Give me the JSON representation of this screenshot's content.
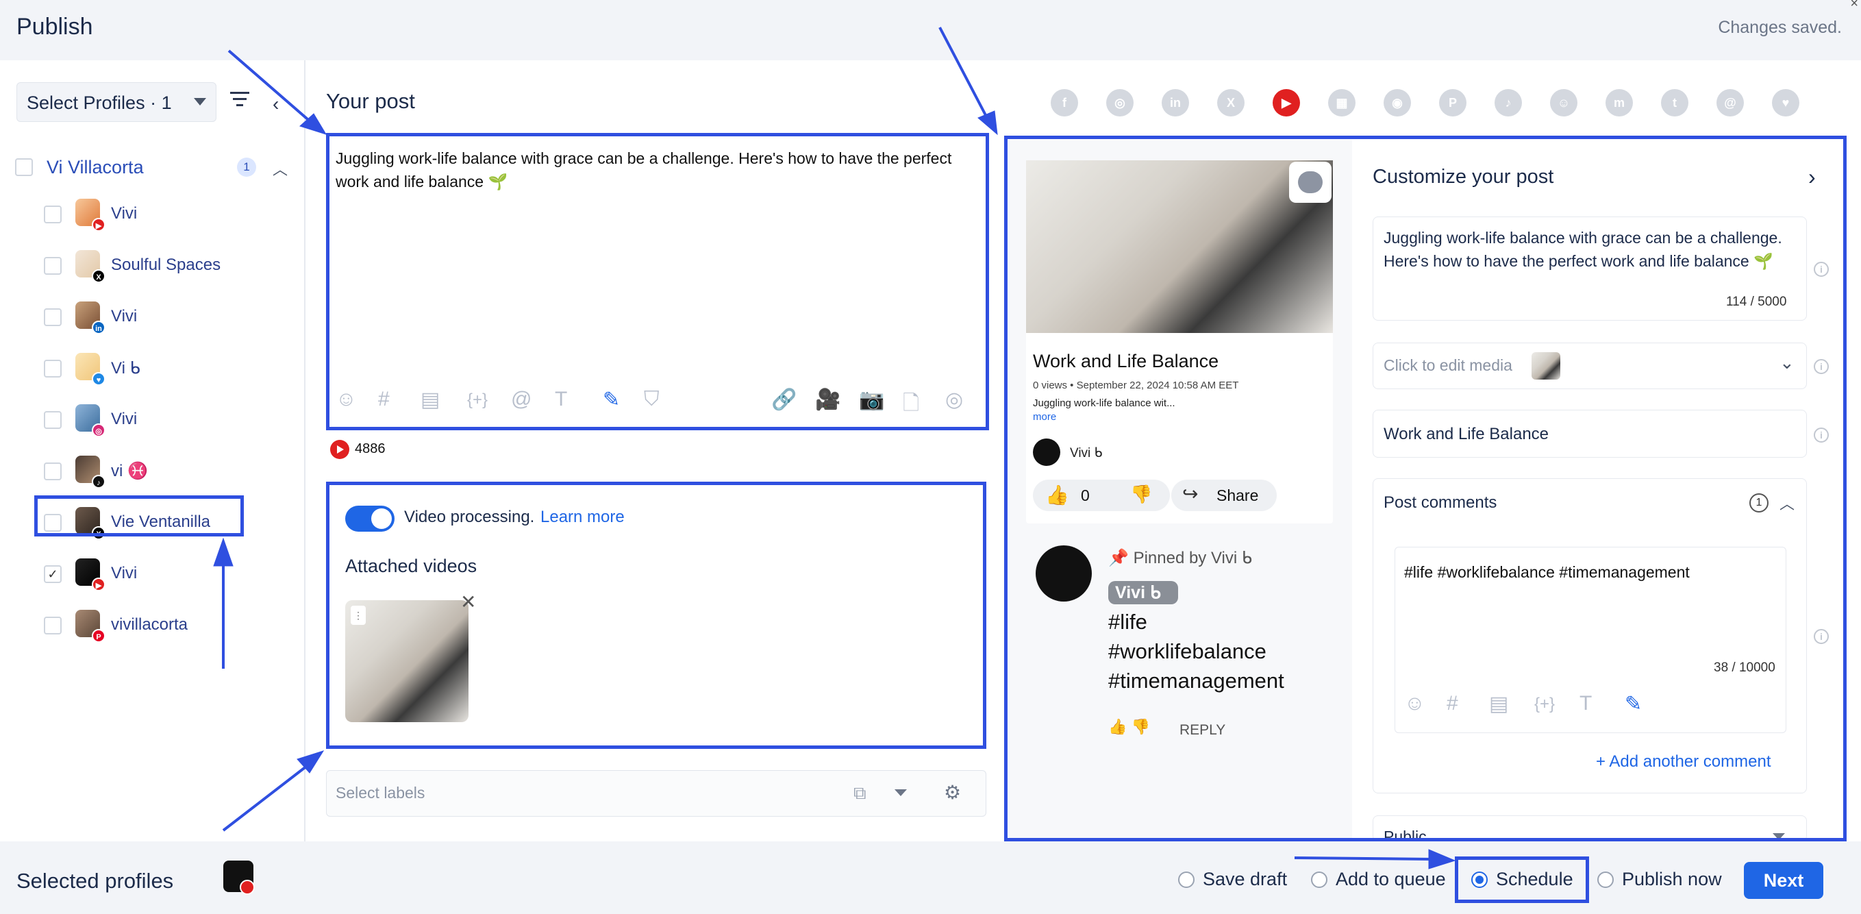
{
  "header": {
    "title": "Publish",
    "status": "Changes saved.",
    "close_glyph": "×"
  },
  "sidebar": {
    "profile_select": "Select Profiles · 1",
    "group": {
      "name": "Vi Villacorta",
      "count": "1"
    },
    "profiles": [
      {
        "name": "Vivi",
        "network": "youtube",
        "checked": false
      },
      {
        "name": "Soulful Spaces",
        "network": "x",
        "checked": false
      },
      {
        "name": "Vivi",
        "network": "linkedin",
        "checked": false
      },
      {
        "name": "Vi ᑲ",
        "network": "bluesky",
        "checked": false
      },
      {
        "name": "Vivi",
        "network": "instagram",
        "checked": false
      },
      {
        "name": "vi ♓",
        "network": "tiktok",
        "checked": false
      },
      {
        "name": "Vie Ventanilla",
        "network": "x",
        "checked": false
      },
      {
        "name": "Vivi",
        "network": "youtube",
        "checked": true
      },
      {
        "name": "vivillacorta",
        "network": "pinterest",
        "checked": false
      }
    ]
  },
  "post": {
    "heading": "Your post",
    "text": "Juggling work-life balance with grace can be a challenge. Here's how to have the perfect work and life balance 🌱",
    "yt_char_count": "4886",
    "video_processing": "Video processing.",
    "learn_more": "Learn more",
    "attached_title": "Attached videos",
    "labels_placeholder": "Select labels"
  },
  "networks": [
    "facebook",
    "instagram",
    "linkedin",
    "x",
    "youtube",
    "google-business",
    "reddit",
    "pinterest",
    "tiktok",
    "snapchat",
    "mastodon",
    "tumblr",
    "threads",
    "bluesky"
  ],
  "preview": {
    "video_title": "Work and Life Balance",
    "meta": "0 views • September 22, 2024 10:58 AM EET",
    "desc": "Juggling work-life balance wit...",
    "more": "more",
    "channel": "Vivi ᑲ",
    "likes": "0",
    "share": "Share",
    "pinned_by": "Pinned by Vivi ᑲ",
    "chip": "Vivi ᑲ",
    "comment": "#life\n#worklifebalance\n#timemanagement",
    "reply": "REPLY"
  },
  "customize": {
    "title": "Customize your post",
    "text": "Juggling work-life balance with grace can be a challenge. Here's how to have the perfect work and life balance 🌱",
    "count": "114 / 5000",
    "media_label": "Click to edit media",
    "video_title": "Work and Life Balance",
    "post_comments": "Post comments",
    "comments_count": "1",
    "comment_text": "#life #worklifebalance #timemanagement",
    "comment_count": "38 / 10000",
    "add_comment": "+ Add another comment",
    "visibility": "Public"
  },
  "footer": {
    "selected_profiles": "Selected profiles",
    "options": [
      {
        "label": "Save draft",
        "selected": false
      },
      {
        "label": "Add to queue",
        "selected": false
      },
      {
        "label": "Schedule",
        "selected": true
      },
      {
        "label": "Publish now",
        "selected": false
      }
    ],
    "next": "Next"
  },
  "colors": {
    "accent": "#1f66e5",
    "annotation": "#2f4fe0",
    "youtube": "#e02020"
  }
}
